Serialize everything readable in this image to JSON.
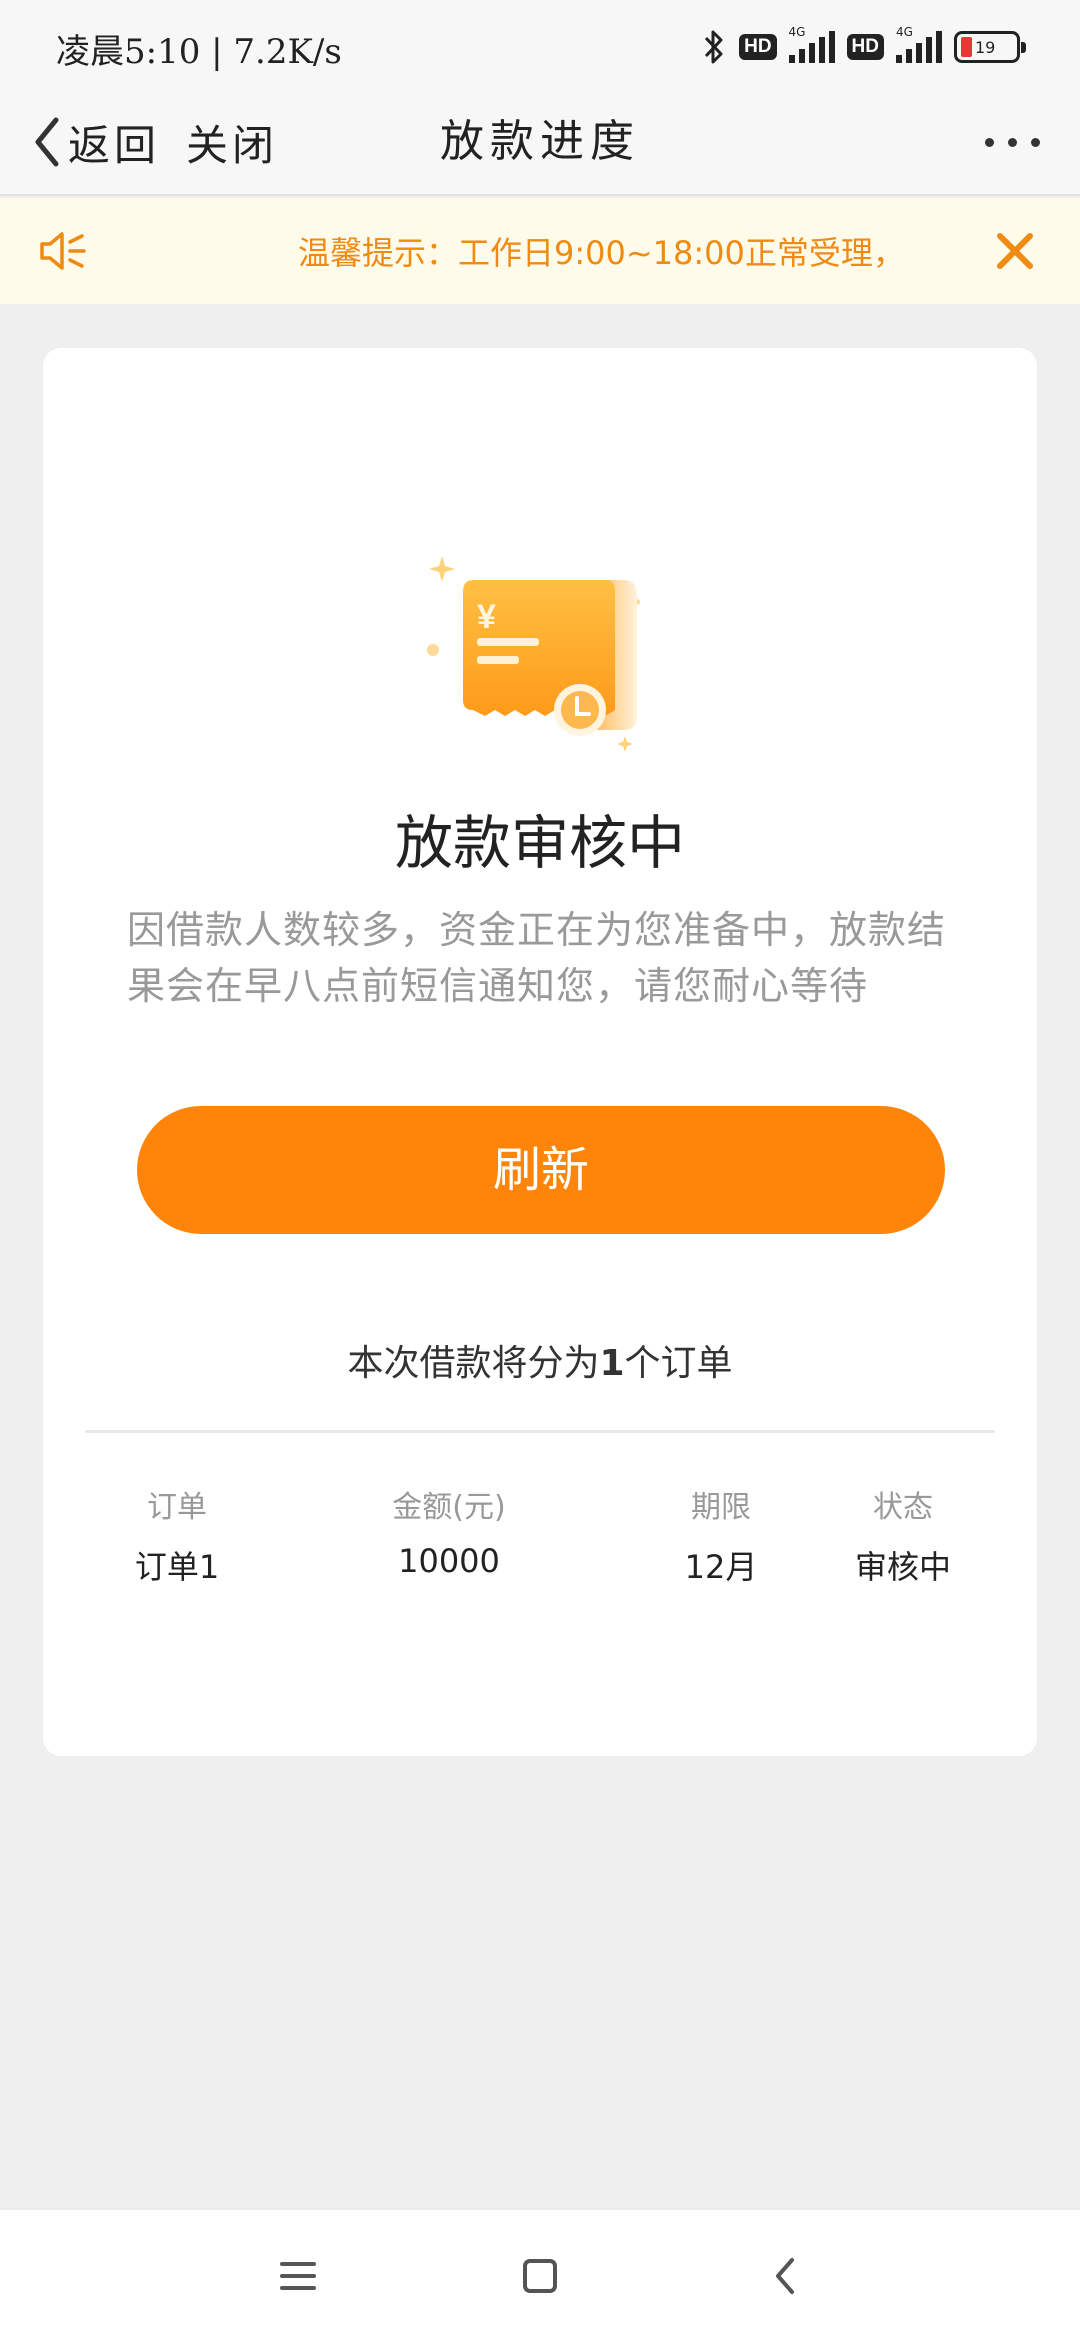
{
  "status_bar": {
    "time": "凌晨5:10 | 7.2K/s",
    "hd_badge": "HD",
    "network": "4G",
    "battery": "19"
  },
  "nav": {
    "back_label": "返回",
    "close_label": "关闭",
    "title": "放款进度"
  },
  "notice": {
    "text": "温馨提示：工作日9:00~18:00正常受理，"
  },
  "card": {
    "title": "放款审核中",
    "description": "因借款人数较多，资金正在为您准备中，放款结果会在早八点前短信通知您，请您耐心等待",
    "refresh_label": "刷新",
    "split_prefix": "本次借款将分为",
    "split_count": "1",
    "split_suffix": "个订单"
  },
  "orders": {
    "headers": [
      "订单",
      "金额(元)",
      "期限",
      "状态"
    ],
    "rows": [
      [
        "订单1",
        "10000",
        "12月",
        "审核中"
      ]
    ]
  },
  "colors": {
    "accent": "#ff850a",
    "notice_text": "#ef8a12",
    "notice_bg": "#fffbea",
    "battery_low": "#e53935"
  },
  "icons": {
    "back": "chevron-left-icon",
    "more": "more-dots-icon",
    "speaker": "speaker-icon",
    "close": "close-icon",
    "illustration": "receipt-clock-icon",
    "menu": "menu-icon",
    "home": "home-icon",
    "nav_back": "back-icon"
  }
}
